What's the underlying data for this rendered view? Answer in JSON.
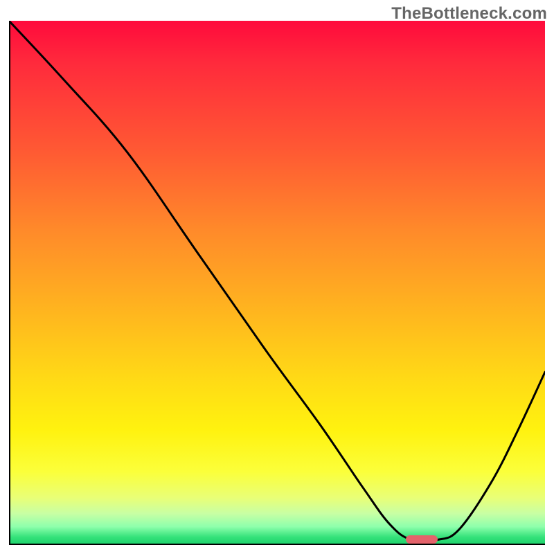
{
  "watermark_text": "TheBottleneck.com",
  "chart_data": {
    "type": "line",
    "title": "",
    "xlabel": "",
    "ylabel": "",
    "xlim": [
      0,
      100
    ],
    "ylim": [
      0,
      100
    ],
    "grid": false,
    "legend": false,
    "series": [
      {
        "name": "bottleneck-curve",
        "x": [
          0,
          10,
          22,
          35,
          48,
          58,
          66,
          71,
          75,
          80,
          84,
          90,
          95,
          100
        ],
        "values": [
          100,
          89,
          75,
          56,
          37,
          23,
          11,
          4,
          1,
          1,
          3,
          12,
          22,
          33
        ]
      }
    ],
    "optimum_marker": {
      "x": 77,
      "y": 1
    },
    "background_gradient": {
      "stops": [
        {
          "pos": 0.0,
          "color": "#ff0a3c"
        },
        {
          "pos": 0.25,
          "color": "#ff5a33"
        },
        {
          "pos": 0.55,
          "color": "#ffb41f"
        },
        {
          "pos": 0.78,
          "color": "#fff20f"
        },
        {
          "pos": 0.92,
          "color": "#e9ff77"
        },
        {
          "pos": 1.0,
          "color": "#1bd06a"
        }
      ]
    }
  }
}
